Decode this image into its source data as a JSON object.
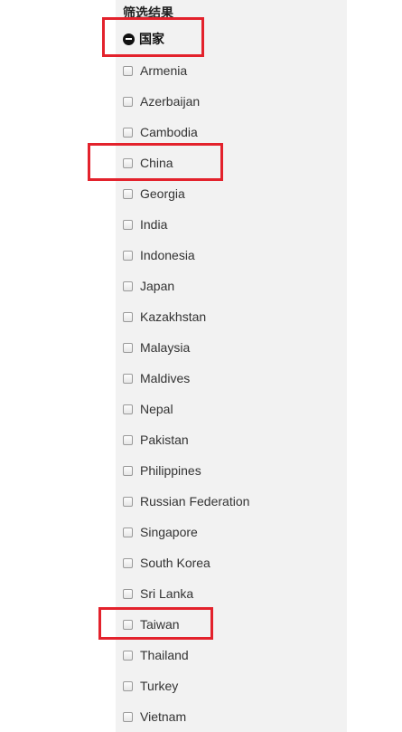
{
  "filter": {
    "heading": "筛选结果",
    "group": {
      "label": "国家",
      "icon": "collapse-minus-icon",
      "expanded": true
    },
    "options": [
      {
        "label": "Armenia",
        "checked": false
      },
      {
        "label": "Azerbaijan",
        "checked": false
      },
      {
        "label": "Cambodia",
        "checked": false
      },
      {
        "label": "China",
        "checked": false
      },
      {
        "label": "Georgia",
        "checked": false
      },
      {
        "label": "India",
        "checked": false
      },
      {
        "label": "Indonesia",
        "checked": false
      },
      {
        "label": "Japan",
        "checked": false
      },
      {
        "label": "Kazakhstan",
        "checked": false
      },
      {
        "label": "Malaysia",
        "checked": false
      },
      {
        "label": "Maldives",
        "checked": false
      },
      {
        "label": "Nepal",
        "checked": false
      },
      {
        "label": "Pakistan",
        "checked": false
      },
      {
        "label": "Philippines",
        "checked": false
      },
      {
        "label": "Russian Federation",
        "checked": false
      },
      {
        "label": "Singapore",
        "checked": false
      },
      {
        "label": "South Korea",
        "checked": false
      },
      {
        "label": "Sri Lanka",
        "checked": false
      },
      {
        "label": "Taiwan",
        "checked": false
      },
      {
        "label": "Thailand",
        "checked": false
      },
      {
        "label": "Turkey",
        "checked": false
      },
      {
        "label": "Vietnam",
        "checked": false
      }
    ]
  },
  "annotations": {
    "highlight_color": "#e3222c",
    "highlighted_items": [
      "国家",
      "China",
      "Taiwan"
    ]
  }
}
